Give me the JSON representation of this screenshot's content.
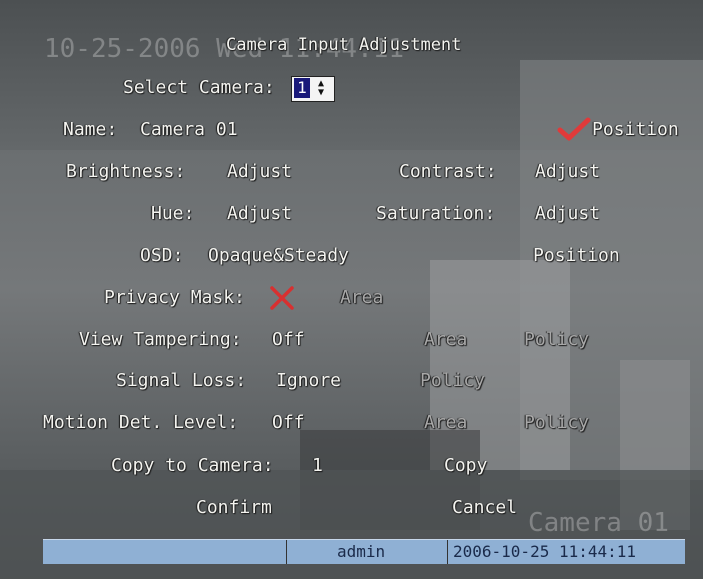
{
  "background": {
    "timestamp_overlay": "10-25-2006 Wed 11:44:11",
    "camera_overlay": "Camera 01"
  },
  "title": "Camera Input Adjustment",
  "select_camera": {
    "label": "Select Camera:",
    "value": "1"
  },
  "name": {
    "label": "Name:",
    "value": "Camera 01"
  },
  "position_check": {
    "label": "Position",
    "checked": true
  },
  "brightness": {
    "label": "Brightness:",
    "button": "Adjust"
  },
  "contrast": {
    "label": "Contrast:",
    "button": "Adjust"
  },
  "hue": {
    "label": "Hue:",
    "button": "Adjust"
  },
  "saturation": {
    "label": "Saturation:",
    "button": "Adjust"
  },
  "osd": {
    "label": "OSD:",
    "value": "Opaque&Steady",
    "position_button": "Position"
  },
  "privacy_mask": {
    "label": "Privacy Mask:",
    "checked": false,
    "area_button": "Area"
  },
  "view_tampering": {
    "label": "View Tampering:",
    "value": "Off",
    "area_button": "Area",
    "policy_button": "Policy"
  },
  "signal_loss": {
    "label": "Signal Loss:",
    "value": "Ignore",
    "policy_button": "Policy"
  },
  "motion_detection": {
    "label": "Motion Det. Level:",
    "value": "Off",
    "area_button": "Area",
    "policy_button": "Policy"
  },
  "copy_to_camera": {
    "label": "Copy to Camera:",
    "value": "1",
    "button": "Copy"
  },
  "buttons": {
    "confirm": "Confirm",
    "cancel": "Cancel"
  },
  "status_bar": {
    "user": "admin",
    "datetime": "2006-10-25 11:44:11"
  },
  "colors": {
    "check": "#e03a3a",
    "cross": "#d83030",
    "status_bar": "#8fb0d4"
  }
}
